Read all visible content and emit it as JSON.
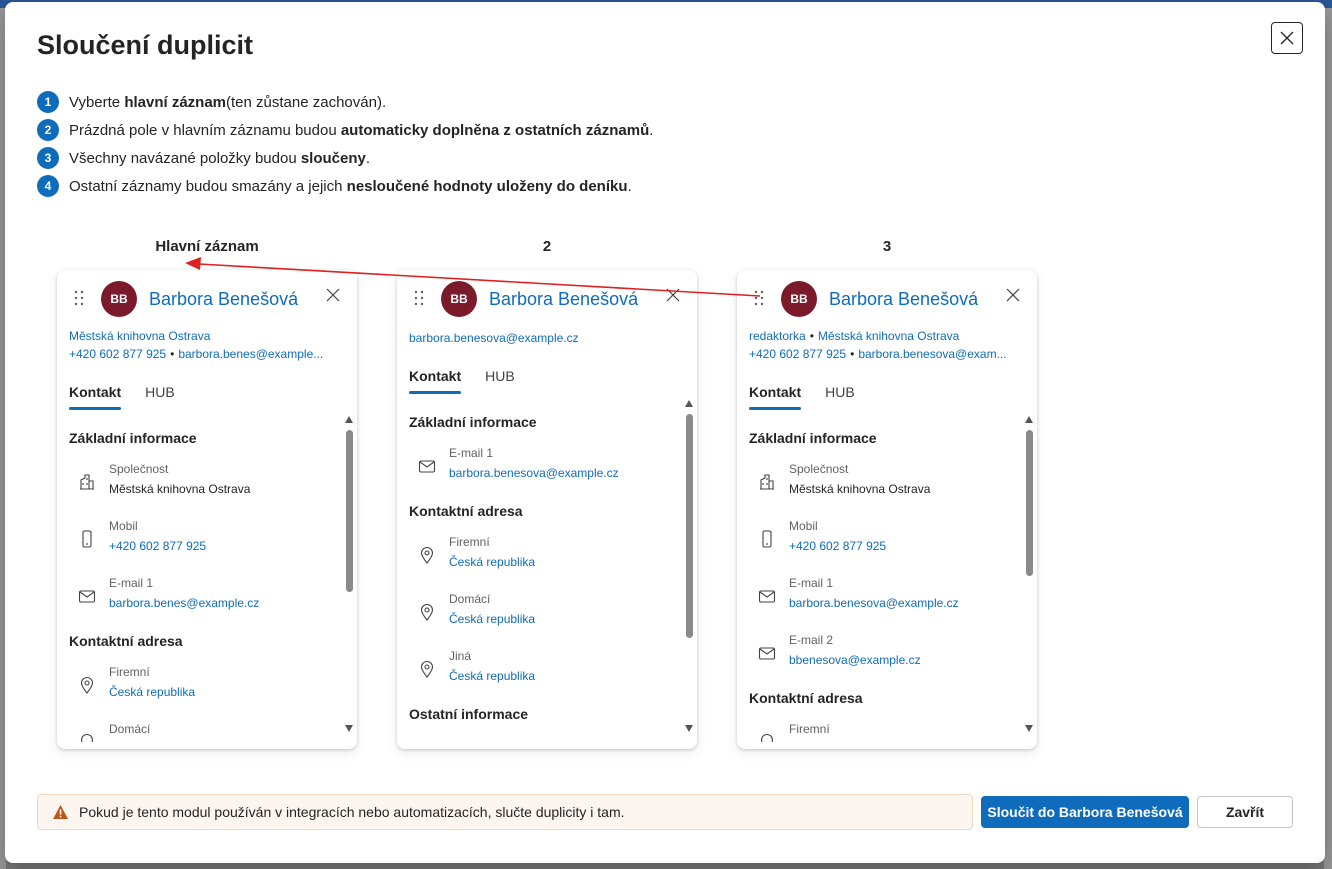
{
  "dialog": {
    "title": "Sloučení duplicit",
    "steps": [
      {
        "num": "1",
        "pre": "Vyberte ",
        "bold": "hlavní záznam",
        "post": " (ten zůstane zachován)."
      },
      {
        "num": "2",
        "pre": "Prázdná pole v hlavním záznamu budou ",
        "bold": "automaticky doplněna z ostatních záznamů",
        "post": "."
      },
      {
        "num": "3",
        "pre": "Všechny navázané položky budou ",
        "bold": "sloučeny",
        "post": "."
      },
      {
        "num": "4",
        "pre": "Ostatní záznamy budou smazány a jejich ",
        "bold": "nesloučené hodnoty uloženy do deníku",
        "post": "."
      }
    ]
  },
  "columns": {
    "labels": [
      "Hlavní záznam",
      "2",
      "3"
    ]
  },
  "cards": [
    {
      "initials": "BB",
      "name": "Barbora Benešová",
      "meta_line1": "Městská knihovna Ostrava",
      "meta_line2_a": "+420 602 877 925",
      "meta_line2_b": "barbora.benes@example...",
      "tabs": [
        "Kontakt",
        "HUB"
      ],
      "sections": [
        {
          "title": "Základní informace",
          "fields": [
            {
              "icon": "building-icon",
              "label": "Společnost",
              "value": "Městská knihovna Ostrava",
              "link": false
            },
            {
              "icon": "phone-icon",
              "label": "Mobil",
              "value": "+420 602 877 925",
              "link": true
            },
            {
              "icon": "mail-icon",
              "label": "E-mail 1",
              "value": "barbora.benes@example.cz",
              "link": true
            }
          ]
        },
        {
          "title": "Kontaktní adresa",
          "fields": [
            {
              "icon": "location-icon",
              "label": "Firemní",
              "value": "Česká republika",
              "link": true
            },
            {
              "icon": "location-icon",
              "label": "Domácí",
              "value": "",
              "link": true
            }
          ]
        }
      ]
    },
    {
      "initials": "BB",
      "name": "Barbora Benešová",
      "meta_line1": "barbora.benesova@example.cz",
      "tabs": [
        "Kontakt",
        "HUB"
      ],
      "sections": [
        {
          "title": "Základní informace",
          "fields": [
            {
              "icon": "mail-icon",
              "label": "E-mail 1",
              "value": "barbora.benesova@example.cz",
              "link": true
            }
          ]
        },
        {
          "title": "Kontaktní adresa",
          "fields": [
            {
              "icon": "location-icon",
              "label": "Firemní",
              "value": "Česká republika",
              "link": true
            },
            {
              "icon": "location-icon",
              "label": "Domácí",
              "value": "Česká republika",
              "link": true
            },
            {
              "icon": "location-icon",
              "label": "Jiná",
              "value": "Česká republika",
              "link": true
            }
          ]
        },
        {
          "title": "Ostatní informace",
          "fields": []
        }
      ]
    },
    {
      "initials": "BB",
      "name": "Barbora Benešová",
      "meta_line1_a": "redaktorka",
      "meta_line1_b": "Městská knihovna Ostrava",
      "meta_line2_a": "+420 602 877 925",
      "meta_line2_b": "barbora.benesova@exam...",
      "tabs": [
        "Kontakt",
        "HUB"
      ],
      "sections": [
        {
          "title": "Základní informace",
          "fields": [
            {
              "icon": "building-icon",
              "label": "Společnost",
              "value": "Městská knihovna Ostrava",
              "link": false
            },
            {
              "icon": "phone-icon",
              "label": "Mobil",
              "value": "+420 602 877 925",
              "link": true
            },
            {
              "icon": "mail-icon",
              "label": "E-mail 1",
              "value": "barbora.benesova@example.cz",
              "link": true
            },
            {
              "icon": "mail-icon",
              "label": "E-mail 2",
              "value": "bbenesova@example.cz",
              "link": true
            }
          ]
        },
        {
          "title": "Kontaktní adresa",
          "fields": [
            {
              "icon": "location-icon",
              "label": "Firemní",
              "value": "",
              "link": true
            }
          ]
        }
      ]
    }
  ],
  "footer": {
    "warning": "Pokud je tento modul používán v integracích nebo automatizacích, slučte duplicity i tam.",
    "merge_button": "Sloučit do Barbora Benešová",
    "close_button": "Zavřít"
  },
  "colors": {
    "accent": "#0f6cbd",
    "avatar": "#7a1a2a",
    "arrow": "#e02020",
    "warning_bg": "#fdf6f0",
    "warning_icon": "#c4551a"
  }
}
